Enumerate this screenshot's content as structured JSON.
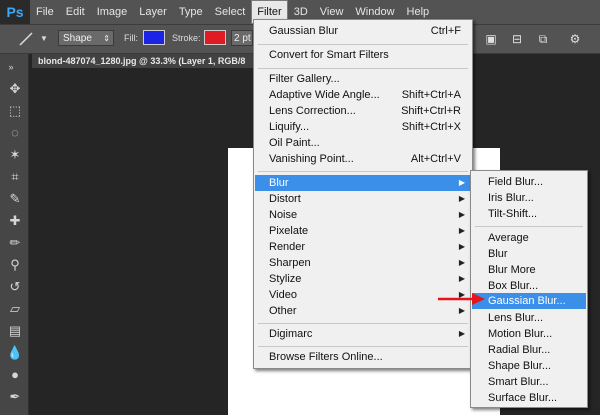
{
  "app": {
    "logo": "Ps"
  },
  "menubar": {
    "items": [
      "File",
      "Edit",
      "Image",
      "Layer",
      "Type",
      "Select",
      "Filter",
      "3D",
      "View",
      "Window",
      "Help"
    ],
    "active": "Filter"
  },
  "options": {
    "shape_mode": "Shape",
    "fill_label": "Fill:",
    "fill_color": "#1a23e6",
    "stroke_label": "Stroke:",
    "stroke_color": "#e01b24",
    "stroke_size": "2 pt"
  },
  "document": {
    "tab_title": "blond-487074_1280.jpg @ 33.3% (Layer 1, RGB/8"
  },
  "filter_menu": {
    "last_filter": {
      "label": "Gaussian Blur",
      "shortcut": "Ctrl+F"
    },
    "convert": "Convert for Smart Filters",
    "group1": [
      {
        "label": "Filter Gallery...",
        "shortcut": ""
      },
      {
        "label": "Adaptive Wide Angle...",
        "shortcut": "Shift+Ctrl+A"
      },
      {
        "label": "Lens Correction...",
        "shortcut": "Shift+Ctrl+R"
      },
      {
        "label": "Liquify...",
        "shortcut": "Shift+Ctrl+X"
      },
      {
        "label": "Oil Paint...",
        "shortcut": ""
      },
      {
        "label": "Vanishing Point...",
        "shortcut": "Alt+Ctrl+V"
      }
    ],
    "submenus": [
      "Blur",
      "Distort",
      "Noise",
      "Pixelate",
      "Render",
      "Sharpen",
      "Stylize",
      "Video",
      "Other"
    ],
    "highlighted": "Blur",
    "digimarc": "Digimarc",
    "browse": "Browse Filters Online..."
  },
  "blur_menu": {
    "group1": [
      "Field Blur...",
      "Iris Blur...",
      "Tilt-Shift..."
    ],
    "group2": [
      "Average",
      "Blur",
      "Blur More",
      "Box Blur...",
      "Gaussian Blur...",
      "Lens Blur...",
      "Motion Blur...",
      "Radial Blur...",
      "Shape Blur...",
      "Smart Blur...",
      "Surface Blur..."
    ],
    "highlighted": "Gaussian Blur..."
  },
  "colors": {
    "highlight": "#3b8fe8",
    "annotation_arrow": "#e8141c"
  }
}
